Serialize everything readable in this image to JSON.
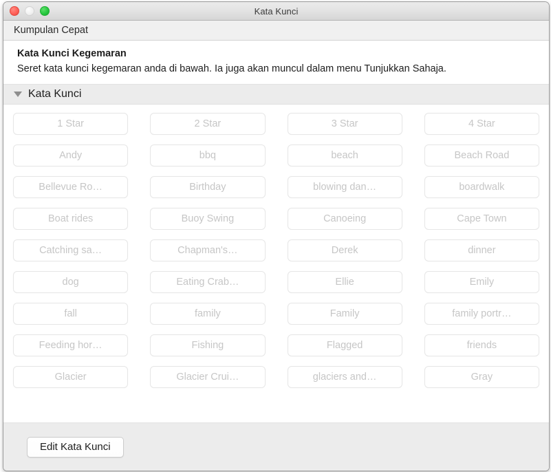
{
  "window": {
    "title": "Kata Kunci",
    "traffic_lights": [
      {
        "name": "close",
        "color": "#ff6159"
      },
      {
        "name": "minimize",
        "color": "#f0f0f0"
      },
      {
        "name": "maximize",
        "color": "#28c840"
      }
    ]
  },
  "toolbar": {
    "title": "Kumpulan Cepat"
  },
  "description": {
    "heading": "Kata Kunci Kegemaran",
    "body": "Seret kata kunci kegemaran anda di bawah. Ia juga akan muncul dalam menu Tunjukkan Sahaja."
  },
  "group": {
    "disclosure_icon": "triangle-down-icon",
    "title": "Kata Kunci",
    "expanded": true
  },
  "keywords": [
    "1 Star",
    "2 Star",
    "3 Star",
    "4 Star",
    "Andy",
    "bbq",
    "beach",
    "Beach Road",
    "Bellevue Ro…",
    "Birthday",
    "blowing dan…",
    "boardwalk",
    "Boat rides",
    "Buoy Swing",
    "Canoeing",
    "Cape Town",
    "Catching sa…",
    "Chapman's…",
    "Derek",
    "dinner",
    "dog",
    "Eating Crab…",
    "Ellie",
    "Emily",
    "fall",
    "family",
    "Family",
    "family portr…",
    "Feeding hor…",
    "Fishing",
    "Flagged",
    "friends",
    "Glacier",
    "Glacier Crui…",
    "glaciers and…",
    "Gray"
  ],
  "footer": {
    "edit_button_label": "Edit Kata Kunci"
  },
  "colors": {
    "titlebar_top": "#ebebeb",
    "titlebar_bottom": "#d6d6d6",
    "band_gray": "#ececec",
    "content_white": "#ffffff",
    "keyword_text": "#c6c6c6",
    "keyword_border": "#e6e6e6",
    "text_primary": "#1d1d1d"
  }
}
